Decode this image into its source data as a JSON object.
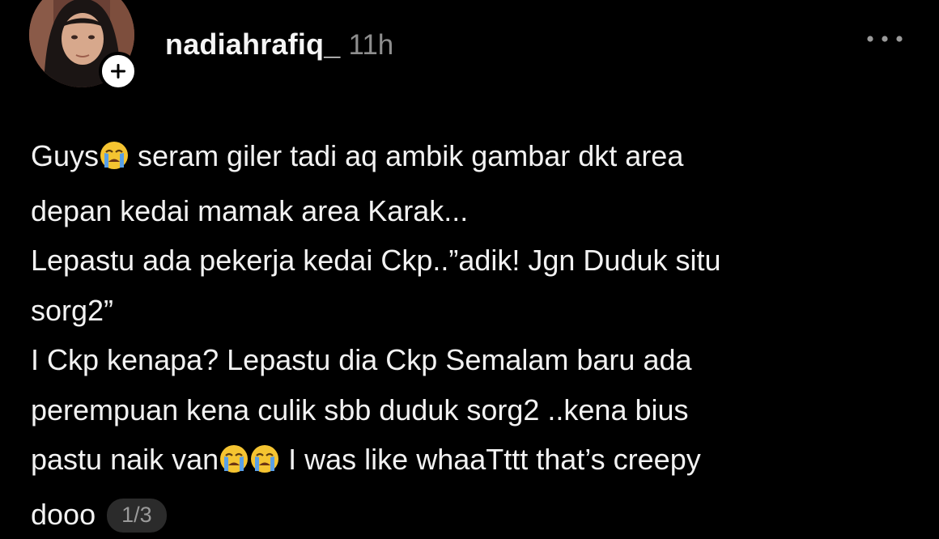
{
  "post": {
    "username": "nadiahrafiq_",
    "timestamp": "11h",
    "lines": {
      "l1a": "Guys",
      "l1b": " seram giler tadi aq ambik gambar dkt area",
      "l2": "depan kedai mamak area Karak...",
      "l3": "Lepastu ada pekerja kedai Ckp..”adik! Jgn Duduk situ",
      "l4": "sorg2”",
      "l5": "I Ckp kenapa? Lepastu dia Ckp Semalam baru ada",
      "l6": "perempuan kena culik sbb duduk sorg2 ..kena bius",
      "l7a": "pastu naik van",
      "l7b": " I was like whaaTttt that’s creepy",
      "l8": "dooo"
    },
    "page_counter": "1/3"
  },
  "icons": {
    "avatar": "profile-photo",
    "follow": "plus-icon",
    "more": "more-horizontal-icon",
    "emoji": "loudly-crying-face-emoji"
  },
  "colors": {
    "background": "#000000",
    "text": "#f2f2f2",
    "muted": "#8e8e8e",
    "badge_bg": "#2b2b2b",
    "emoji_face": "#f5c431",
    "emoji_tears": "#5aa0e6"
  }
}
